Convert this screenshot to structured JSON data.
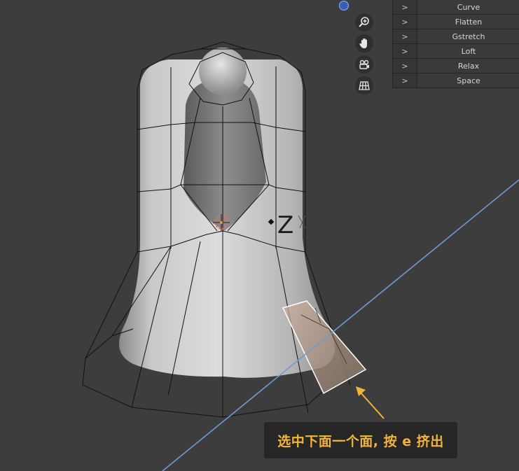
{
  "viewport": {
    "background": "#3d3d3d",
    "axis_label": "Z"
  },
  "nav_buttons": [
    {
      "name": "zoom-icon",
      "icon": "magnifier-plus"
    },
    {
      "name": "hand-icon",
      "icon": "pan-hand"
    },
    {
      "name": "camera-icon",
      "icon": "camera-view"
    },
    {
      "name": "grid-icon",
      "icon": "perspective-grid"
    }
  ],
  "panel": {
    "items": [
      {
        "chevron": ">",
        "label": "Curve"
      },
      {
        "chevron": ">",
        "label": "Flatten"
      },
      {
        "chevron": ">",
        "label": "Gstretch"
      },
      {
        "chevron": ">",
        "label": "Loft"
      },
      {
        "chevron": ">",
        "label": "Relax"
      },
      {
        "chevron": ">",
        "label": "Space"
      }
    ]
  },
  "callout": {
    "text": "选中下面一个面, 按 e 挤出",
    "color": "#f2b43a"
  },
  "colors": {
    "selected_face": "#b59a86",
    "origin": "#ff6a3a",
    "guide_line": "#6e9ad6"
  }
}
